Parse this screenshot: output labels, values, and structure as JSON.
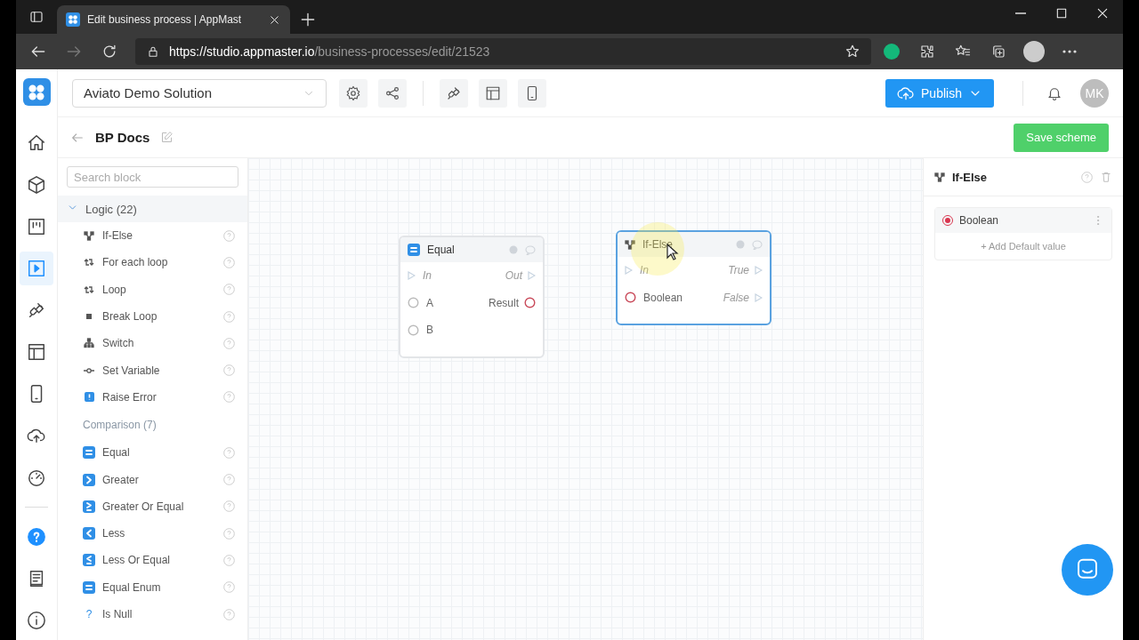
{
  "browser": {
    "tab_title": "Edit business process | AppMast",
    "url_host": "https://studio.appmaster.io",
    "url_path": "/business-processes/edit/21523"
  },
  "header": {
    "solution": "Aviato Demo Solution",
    "publish": "Publish",
    "avatar": "MK"
  },
  "rail": [
    {
      "kind": "home",
      "selected": false
    },
    {
      "kind": "cube",
      "selected": false
    },
    {
      "kind": "board",
      "selected": false
    },
    {
      "kind": "play",
      "selected": true
    },
    {
      "kind": "plug",
      "selected": false
    },
    {
      "kind": "layout",
      "selected": false
    },
    {
      "kind": "phone",
      "selected": false
    },
    {
      "kind": "cloud",
      "selected": false
    },
    {
      "kind": "gauge",
      "selected": false
    },
    {
      "kind": "help",
      "selected": false
    },
    {
      "kind": "book",
      "selected": false
    },
    {
      "kind": "info",
      "selected": false
    }
  ],
  "page": {
    "title": "BP Docs",
    "save": "Save scheme"
  },
  "palette": {
    "search_placeholder": "Search block",
    "category": {
      "title": "Logic (22)",
      "expanded": true
    },
    "sections": [
      {
        "items": [
          {
            "label": "If-Else",
            "kind": "branch"
          },
          {
            "label": "For each loop",
            "kind": "loop"
          },
          {
            "label": "Loop",
            "kind": "loop"
          },
          {
            "label": "Break Loop",
            "kind": "stop"
          },
          {
            "label": "Switch",
            "kind": "tree"
          },
          {
            "label": "Set Variable",
            "kind": "variable"
          },
          {
            "label": "Raise Error",
            "kind": "error"
          }
        ]
      },
      {
        "title": "Comparison (7)",
        "items": [
          {
            "label": "Equal",
            "kind": "eq"
          },
          {
            "label": "Greater",
            "kind": "gt"
          },
          {
            "label": "Greater Or Equal",
            "kind": "gte"
          },
          {
            "label": "Less",
            "kind": "lt"
          },
          {
            "label": "Less Or Equal",
            "kind": "lte"
          },
          {
            "label": "Equal Enum",
            "kind": "eq"
          },
          {
            "label": "Is Null",
            "kind": "glyph",
            "glyph": "?"
          }
        ]
      }
    ]
  },
  "nodes": [
    {
      "title": "Equal",
      "kind": "eq",
      "selected": false,
      "inputs": [
        {
          "label": "In",
          "kind": "flow"
        },
        {
          "label": "A",
          "kind": "data",
          "color": "#bbbbbb"
        },
        {
          "label": "B",
          "kind": "data",
          "color": "#bbbbbb"
        }
      ],
      "outputs": [
        {
          "label": "Out",
          "kind": "flow"
        },
        {
          "label": "Result",
          "kind": "data",
          "color": "#c94a5a"
        }
      ]
    },
    {
      "title": "If-Else",
      "kind": "branch",
      "selected": true,
      "inputs": [
        {
          "label": "In",
          "kind": "flow"
        },
        {
          "label": "Boolean",
          "kind": "data",
          "color": "#c94a5a"
        }
      ],
      "outputs": [
        {
          "label": "True",
          "kind": "flow"
        },
        {
          "label": "False",
          "kind": "flow"
        }
      ]
    }
  ],
  "inspector": {
    "title": "If-Else",
    "params": [
      {
        "label": "Boolean",
        "color": "#d9364f",
        "action": "+ Add Default value"
      }
    ]
  }
}
